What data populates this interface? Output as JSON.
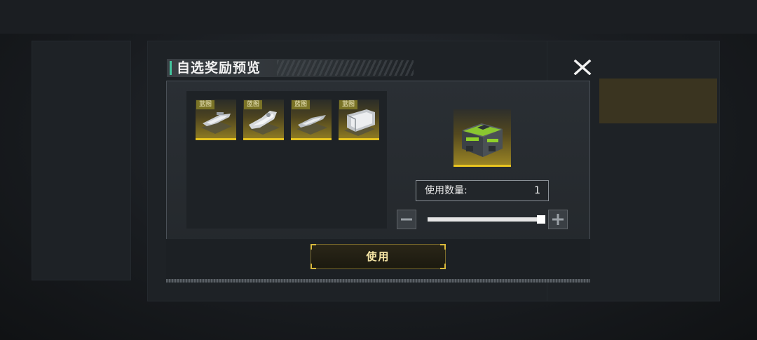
{
  "dialog": {
    "title": "自选奖励预览",
    "accent_color": "#43c59e",
    "close_icon": "close-icon"
  },
  "rewards": [
    {
      "tag": "蓝图",
      "icon": "spaceship-blueprint-icon"
    },
    {
      "tag": "蓝图",
      "icon": "spaceship-blueprint-icon"
    },
    {
      "tag": "蓝图",
      "icon": "spaceship-blueprint-icon"
    },
    {
      "tag": "蓝图",
      "icon": "spaceship-blueprint-icon"
    }
  ],
  "selected_item": {
    "icon": "supply-crate-icon"
  },
  "quantity": {
    "label": "使用数量:",
    "value": "1",
    "slider_fraction": 1.0
  },
  "controls": {
    "minus_icon": "minus-icon",
    "plus_icon": "plus-icon",
    "use_label": "使用"
  },
  "colors": {
    "rarity_gold": "#e4c21f",
    "button_text": "#f6e6a6"
  }
}
